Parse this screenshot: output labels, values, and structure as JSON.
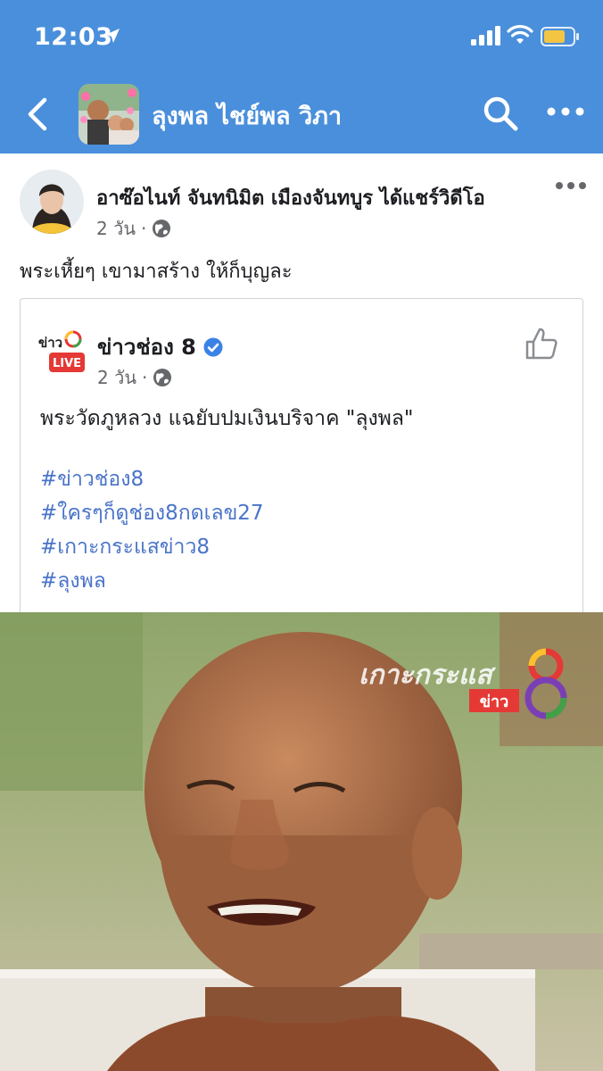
{
  "status_bar": {
    "time": "12:03",
    "icons": [
      "location-arrow-icon",
      "cellular-signal-icon",
      "wifi-icon",
      "battery-icon"
    ],
    "battery_color": "#f4c542"
  },
  "nav": {
    "title": "ลุงพล ไชย์พล วิภา",
    "icons": [
      "back-chevron-icon",
      "search-icon",
      "more-dots-icon"
    ],
    "background": "#4a8fdb"
  },
  "post": {
    "author": "อาซ๊อไนท์ จันทนิมิต เมืองจันทบูร",
    "action": "ได้แชร์วิดีโอ",
    "time": "2 วัน",
    "separator": "·",
    "caption": "พระเหี้ยๆ เขามาสร้าง ให้ก็บุญละ"
  },
  "shared": {
    "logo_text": "ข่าว",
    "logo_live": "LIVE",
    "page_name": "ข่าวช่อง 8",
    "time": "2 วัน",
    "separator": "·",
    "text": "พระวัดภูหลวง แฉยับปมเงินบริจาค \"ลุงพล\"",
    "hashtags": [
      "#ข่าวช่อง8",
      "#ใครๆก็ดูช่อง8กดเลข27",
      "#เกาะกระแสข่าว8",
      "#ลุงพล"
    ],
    "link_color": "#4a74c9"
  },
  "video": {
    "watermark_top": "เกาะกระแส",
    "watermark_badge": "ข่าว",
    "watermark_number": "8"
  }
}
